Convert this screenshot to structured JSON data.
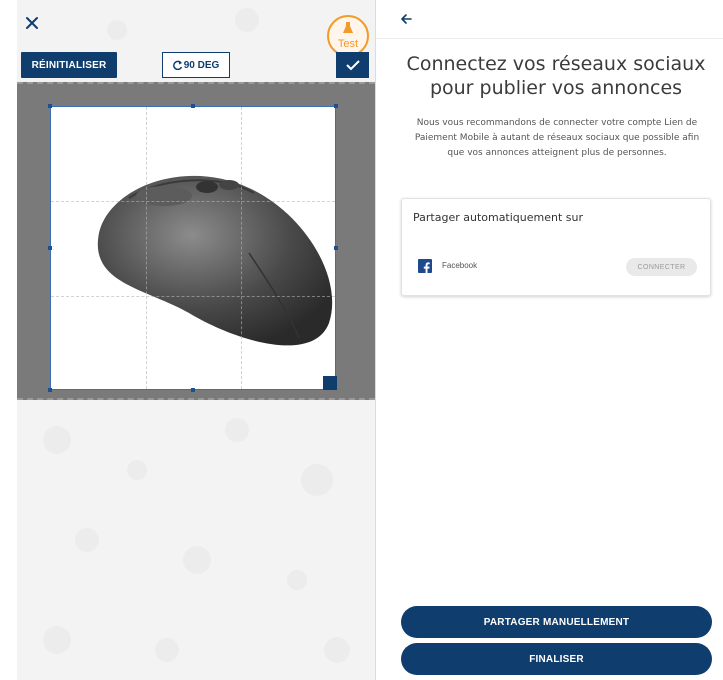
{
  "editor": {
    "reset_label": "RÉINITIALISER",
    "rotate_label": "90 DEG",
    "test_badge": "Test",
    "colors": {
      "primary": "#0f3d6e",
      "badge": "#f39a2b",
      "crop_bg": "#7a7a7a"
    },
    "icons": [
      "close-icon",
      "flask-icon",
      "rotate-icon",
      "check-icon"
    ]
  },
  "social": {
    "title": "Connectez vos réseaux sociaux pour publier vos annonces",
    "subtitle": "Nous vous recommandons de connecter votre compte Lien de Paiement Mobile à autant de réseaux sociaux que possible afin que vos annonces atteignent plus de personnes.",
    "card": {
      "heading": "Partager automatiquement sur",
      "networks": [
        {
          "name": "Facebook",
          "icon": "facebook-icon",
          "action_label": "CONNECTER"
        }
      ]
    },
    "buttons": {
      "share_manually": "PARTAGER MANUELLEMENT",
      "finish": "FINALISER"
    },
    "icons": [
      "back-arrow-icon"
    ]
  }
}
